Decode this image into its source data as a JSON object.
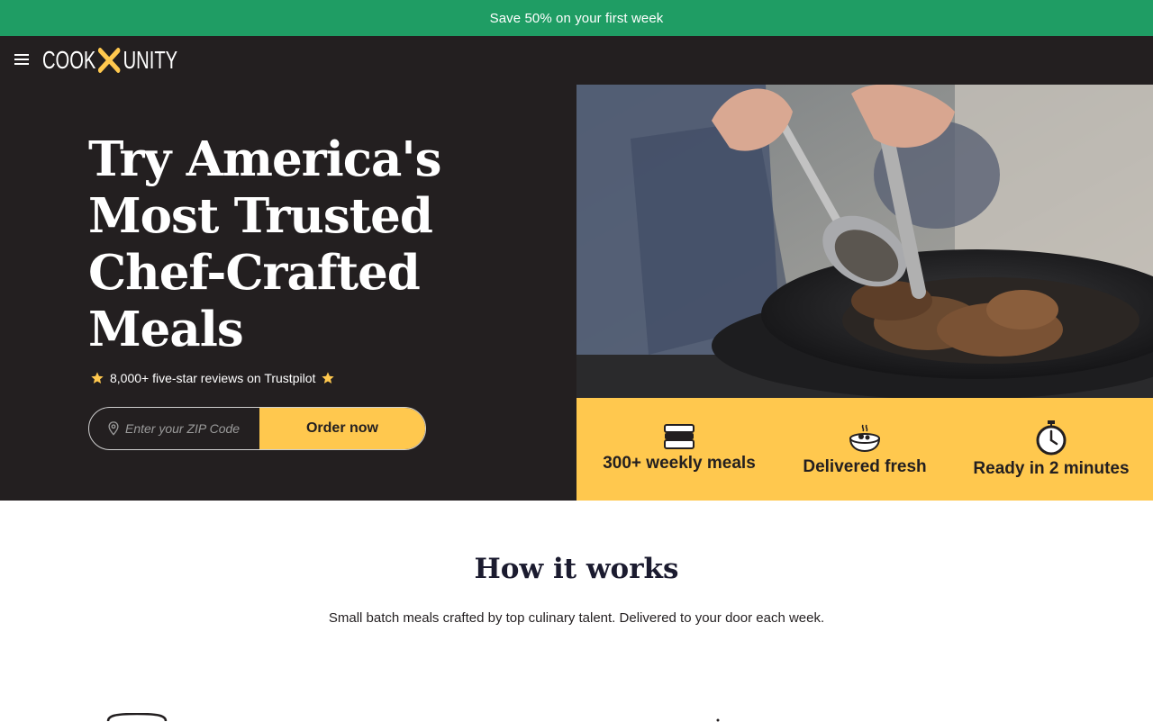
{
  "promo": {
    "text": "Save 50% on your first week"
  },
  "header": {
    "logo_left": "COOK",
    "logo_right": "UNITY",
    "menu_icon": "hamburger-icon"
  },
  "hero": {
    "title": "Try America's Most Trusted Chef-Crafted Meals",
    "reviews": "8,000+ five-star reviews on Trustpilot",
    "zip_placeholder": "Enter your ZIP Code",
    "zip_value": "",
    "order_label": "Order now"
  },
  "features": [
    {
      "label": "300+ weekly meals",
      "icon": "meal-containers-icon"
    },
    {
      "label": "Delivered fresh",
      "icon": "bowl-icon"
    },
    {
      "label": "Ready in 2 minutes",
      "icon": "stopwatch-icon"
    }
  ],
  "how": {
    "title": "How it works",
    "subtitle": "Small batch meals crafted by top culinary talent. Delivered to your door each week."
  },
  "colors": {
    "promo_green": "#1f9d64",
    "dark": "#231f20",
    "accent_yellow": "#ffc84e"
  }
}
